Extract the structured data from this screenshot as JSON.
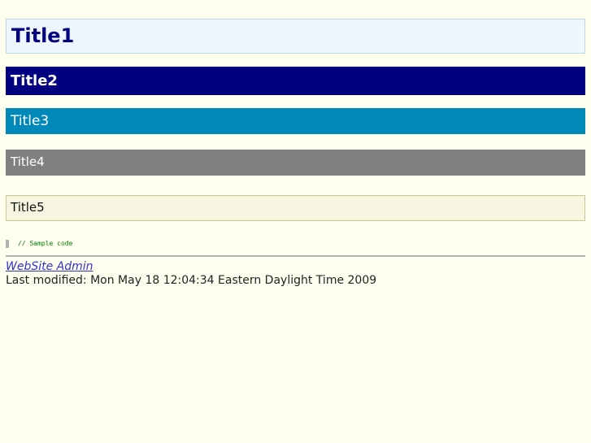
{
  "headings": {
    "title1": "Title1",
    "title2": "Title2",
    "title3": "Title3",
    "title4": "Title4",
    "title5": "Title5"
  },
  "code_sample": "// Sample code",
  "footer": {
    "admin_link": "WebSite Admin",
    "last_modified": "Last modified: Mon May 18 12:04:34 Eastern Daylight Time 2009"
  },
  "colors": {
    "background": "#fffff0",
    "title1_bg": "#eef6ff",
    "title2_bg": "#000080",
    "title3_bg": "#0088b8",
    "title4_bg": "#808080",
    "title5_bg": "#f5f5e0",
    "code_text": "#008000",
    "link": "#3333cc"
  }
}
